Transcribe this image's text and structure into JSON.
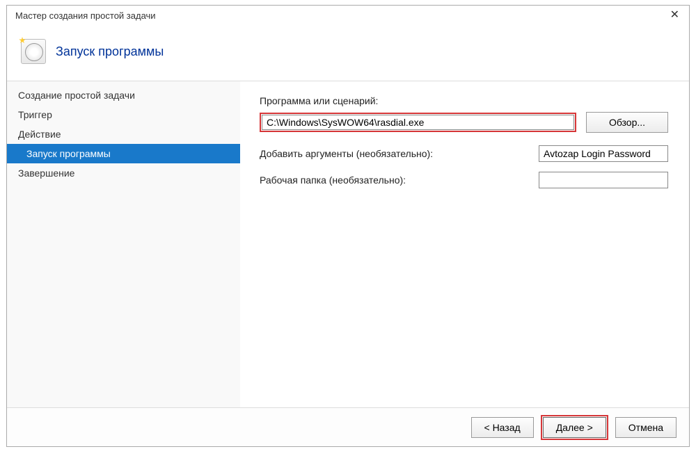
{
  "window": {
    "title": "Мастер создания простой задачи"
  },
  "header": {
    "page_title": "Запуск программы"
  },
  "sidebar": {
    "items": [
      {
        "label": "Создание простой задачи",
        "indent": false,
        "active": false
      },
      {
        "label": "Триггер",
        "indent": false,
        "active": false
      },
      {
        "label": "Действие",
        "indent": false,
        "active": false
      },
      {
        "label": "Запуск программы",
        "indent": true,
        "active": true
      },
      {
        "label": "Завершение",
        "indent": false,
        "active": false
      }
    ]
  },
  "content": {
    "program_label": "Программа или сценарий:",
    "program_value": "C:\\Windows\\SysWOW64\\rasdial.exe",
    "browse_label": "Обзор...",
    "args_label": "Добавить аргументы (необязательно):",
    "args_value": "Avtozap Login Password",
    "workdir_label": "Рабочая папка (необязательно):",
    "workdir_value": ""
  },
  "footer": {
    "back_label": "< Назад",
    "next_label": "Далее >",
    "cancel_label": "Отмена"
  }
}
